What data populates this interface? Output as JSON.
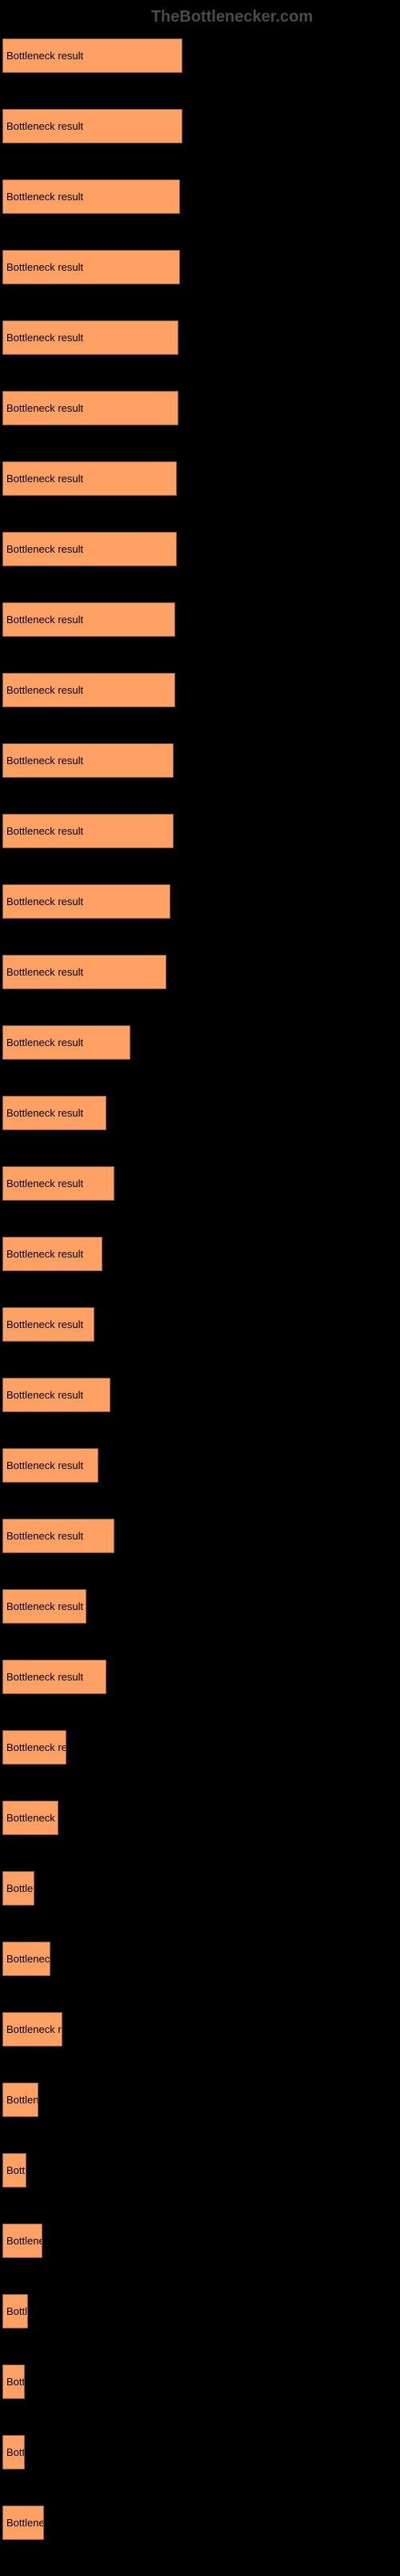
{
  "watermark": "TheBottlenecker.com",
  "chart_data": {
    "type": "bar",
    "title": "",
    "xlabel": "",
    "ylabel": "",
    "bar_label": "Bottleneck result",
    "bar_color": "#ffa165",
    "max_width": 230,
    "values": [
      225,
      225,
      222,
      222,
      220,
      220,
      218,
      218,
      216,
      216,
      214,
      214,
      210,
      205,
      160,
      130,
      140,
      125,
      115,
      135,
      120,
      140,
      105,
      130,
      80,
      70,
      40,
      60,
      75,
      45,
      30,
      50,
      32,
      28,
      28,
      52
    ]
  }
}
